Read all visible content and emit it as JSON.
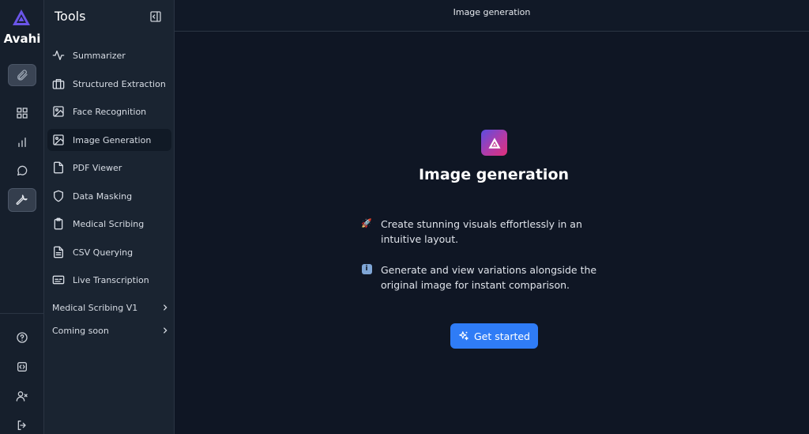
{
  "brand": {
    "name": "Avahi",
    "logo_icon": "triangle-logo-icon",
    "accent": "#6b55e8"
  },
  "rail": {
    "top_items": [
      {
        "name": "attachment",
        "icon": "paperclip-icon"
      },
      {
        "name": "dashboard",
        "icon": "grid-icon"
      },
      {
        "name": "analytics",
        "icon": "bar-chart-icon"
      },
      {
        "name": "chat",
        "icon": "chat-bubble-icon"
      },
      {
        "name": "tools",
        "icon": "wrench-icon"
      }
    ],
    "bottom_items": [
      {
        "name": "help",
        "icon": "help-circle-icon"
      },
      {
        "name": "code",
        "icon": "code-icon"
      },
      {
        "name": "user-remove",
        "icon": "user-x-icon"
      },
      {
        "name": "logout",
        "icon": "logout-icon"
      }
    ]
  },
  "sidebar": {
    "title": "Tools",
    "items": [
      {
        "label": "Summarizer",
        "icon": "activity-icon"
      },
      {
        "label": "Structured Extraction",
        "icon": "briefcase-icon"
      },
      {
        "label": "Face Recognition",
        "icon": "image-icon"
      },
      {
        "label": "Image Generation",
        "icon": "image-icon",
        "active": true
      },
      {
        "label": "PDF Viewer",
        "icon": "file-icon"
      },
      {
        "label": "Data Masking",
        "icon": "shield-icon"
      },
      {
        "label": "Medical Scribing",
        "icon": "clipboard-icon"
      },
      {
        "label": "CSV Querying",
        "icon": "file-text-icon"
      },
      {
        "label": "Live Transcription",
        "icon": "captions-icon"
      }
    ],
    "groups": [
      {
        "label": "Medical Scribing V1",
        "icon": "chevron-right-icon"
      },
      {
        "label": "Coming soon",
        "icon": "chevron-right-icon"
      }
    ]
  },
  "header": {
    "title": "Image generation"
  },
  "main": {
    "title": "Image generation",
    "points": [
      {
        "icon": "rocket-emoji",
        "emoji": "🚀",
        "text": "Create stunning visuals effortlessly in an intuitive layout."
      },
      {
        "icon": "info-emoji",
        "emoji": "i",
        "text": "Generate and view variations alongside the original image for instant comparison."
      }
    ],
    "cta_label": "Get started",
    "cta_icon": "sparkles-icon",
    "cta_color": "#2f7cf6"
  }
}
